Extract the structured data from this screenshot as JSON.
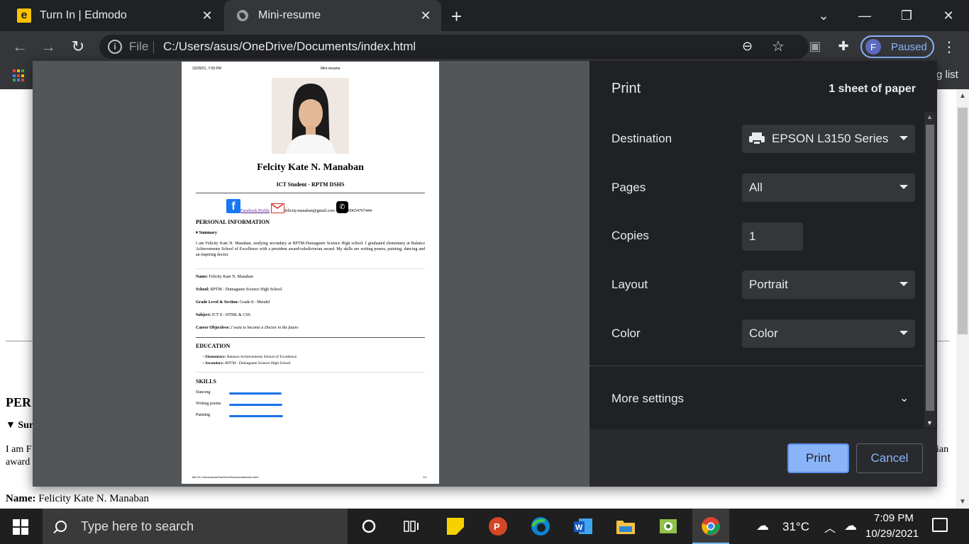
{
  "browser": {
    "tabs": [
      {
        "title": "Turn In | Edmodo",
        "icon": "edmodo-icon",
        "active": false
      },
      {
        "title": "Mini-resume",
        "icon": "globe-icon",
        "active": true
      }
    ],
    "address": {
      "scheme_label": "File",
      "url": "C:/Users/asus/OneDrive/Documents/index.html"
    },
    "profile": {
      "initial": "F",
      "status": "Paused"
    },
    "bookmarks": {
      "reading_list": "g list"
    }
  },
  "page_behind": {
    "heading": "PER",
    "summary": "▼ Sur",
    "line1": "I am F",
    "line2": "award",
    "line1_tail": "ian",
    "name_label": "Name:",
    "name_value": "Felicity Kate N. Manaban"
  },
  "print_preview": {
    "header_date": "10/29/21, 7:09 PM",
    "header_title": "Mini-resume",
    "name": "Felcity Kate N. Manaban",
    "role": "ICT Student - RPTM DSHS",
    "contact": {
      "facebook": "Facebook Profile",
      "email": "felicity.manaban@gmail.com",
      "phone": "09654767444"
    },
    "personal_heading": "PERSONAL INFORMATION",
    "summary_label": "▾ Summary",
    "summary_text": "I am Felicity Kate N. Manaban, studying secondary at RPTM-Dumaguete Science High school. I graduated elementary at Balance Achievements School of Excellence with a president award/valedictorian award. My skills are writing poems, painting, dancing and an inspiring doctor.",
    "fields": [
      {
        "label": "Name:",
        "value": "Felicity Kate N. Manaban"
      },
      {
        "label": "School:",
        "value": "RPTM - Dumaguete Science High School"
      },
      {
        "label": "Grade Level & Section:",
        "value": "Grade 8 - Mendel"
      },
      {
        "label": "Subject:",
        "value": "ICT 8 - HTML & CSS"
      },
      {
        "label": "Career Objectives:",
        "value": "I want to become a Doctor in the future"
      }
    ],
    "education_heading": "EDUCATION",
    "education": [
      {
        "label": "Elementary:",
        "value": "Balance Achievements School of Excellence"
      },
      {
        "label": "Secondary:",
        "value": "RPTM - Dumaguete Science High School"
      }
    ],
    "skills_heading": "SKILLS",
    "skills": [
      "Dancing",
      "Writing poems",
      "Painting"
    ],
    "footer_path": "file:///C:/Users/asus/OneDrive/Documents/index.html",
    "footer_page": "1/1"
  },
  "print_settings": {
    "title": "Print",
    "sheets": "1 sheet of paper",
    "destination_label": "Destination",
    "destination_value": "EPSON L3150 Series",
    "pages_label": "Pages",
    "pages_value": "All",
    "copies_label": "Copies",
    "copies_value": "1",
    "layout_label": "Layout",
    "layout_value": "Portrait",
    "color_label": "Color",
    "color_value": "Color",
    "more_settings": "More settings",
    "print_button": "Print",
    "cancel_button": "Cancel"
  },
  "taskbar": {
    "search_placeholder": "Type here to search",
    "temperature": "31°C",
    "time": "7:09 PM",
    "date": "10/29/2021"
  },
  "colors": {
    "accent": "#8ab4f8",
    "dialog_bg": "#202124",
    "field_bg": "#35363a",
    "skill_bar": "#1a73e8"
  }
}
